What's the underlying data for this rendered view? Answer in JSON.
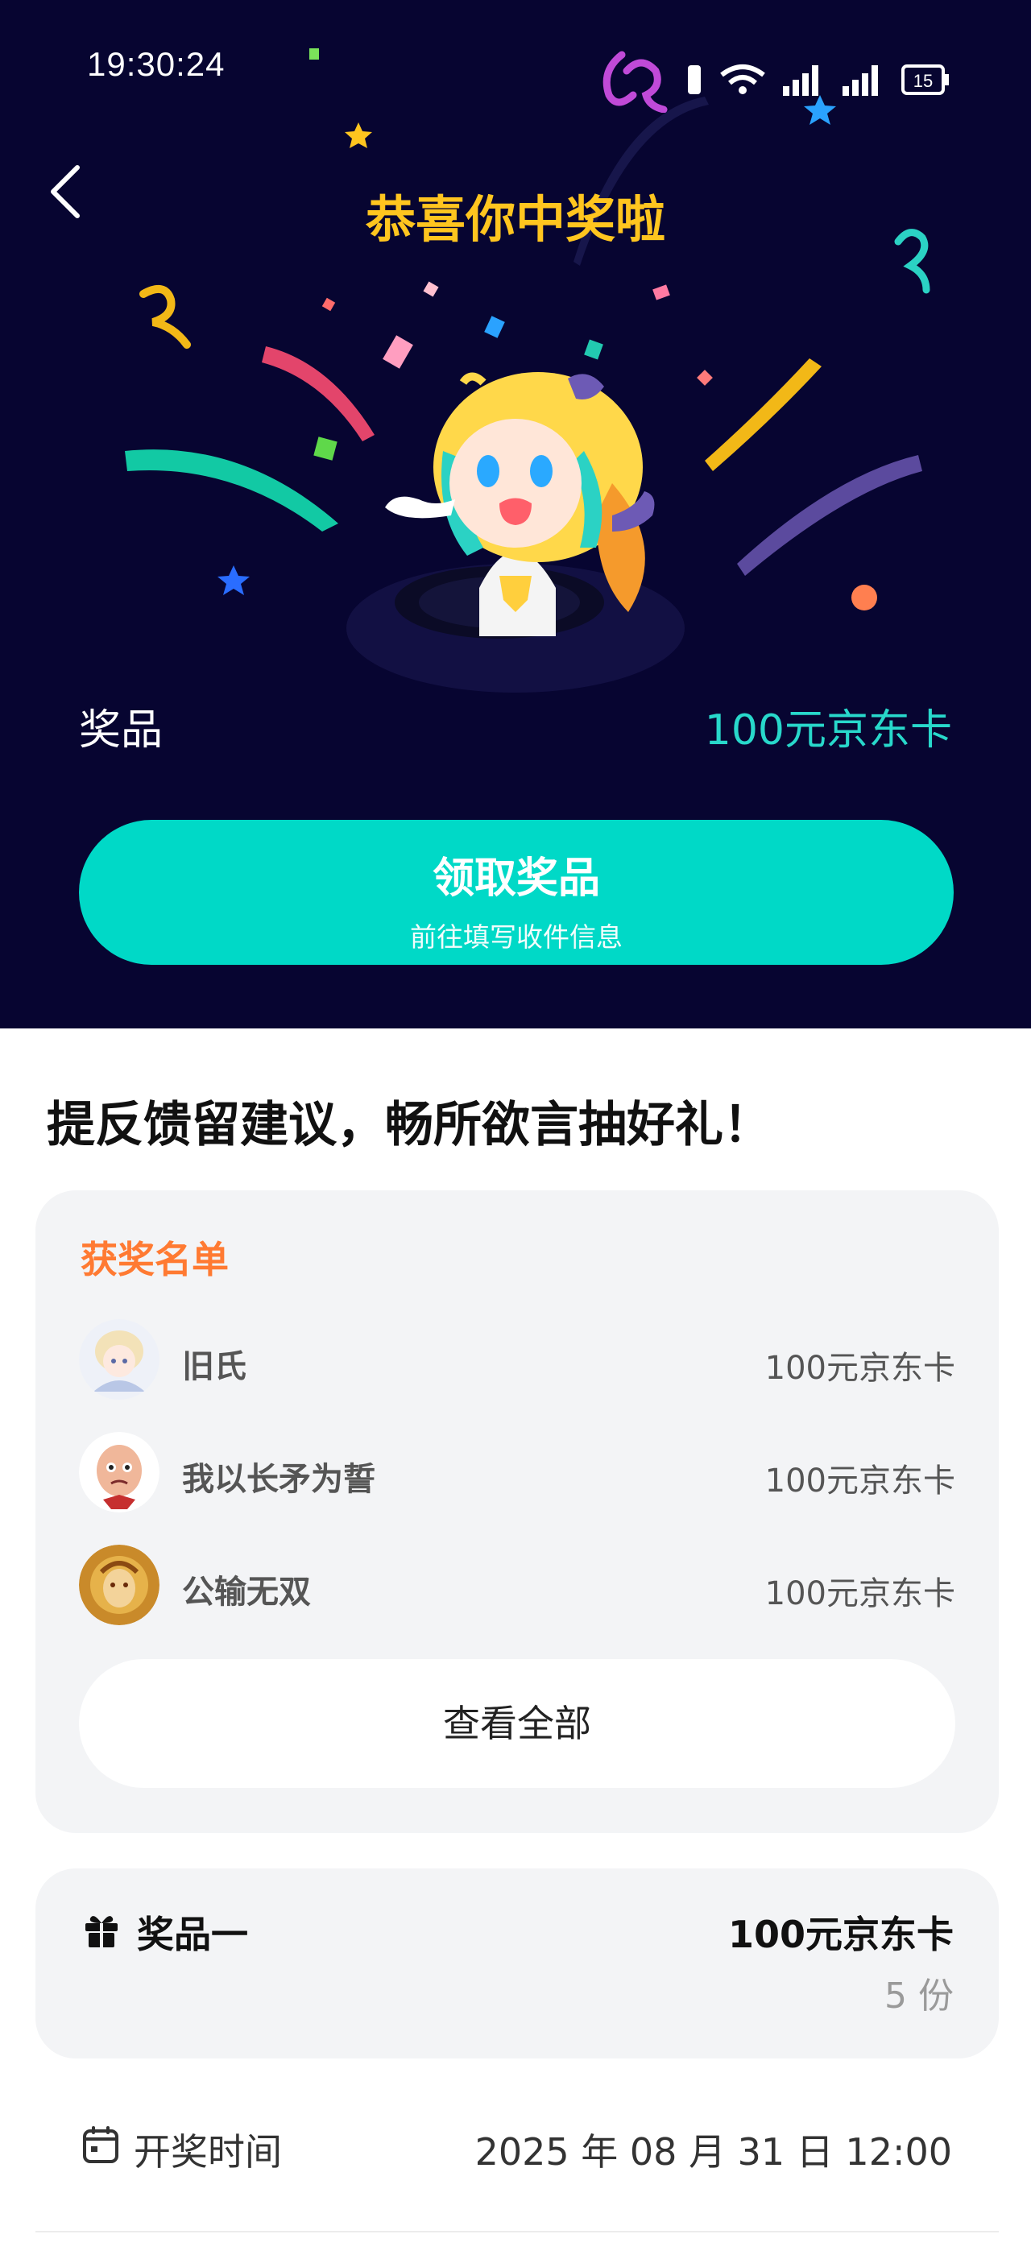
{
  "status_bar": {
    "time": "19:30:24",
    "icons": [
      "app-logo-icon",
      "vibrate-icon",
      "wifi-icon",
      "signal-icon",
      "signal-icon",
      "battery-icon"
    ],
    "battery_level": "15"
  },
  "hero": {
    "title": "恭喜你中奖啦",
    "prize_label": "奖品",
    "prize_value": "100元京东卡",
    "claim_button": {
      "label": "领取奖品",
      "sublabel": "前往填写收件信息"
    },
    "colors": {
      "background": "#070531",
      "title": "#ffc51f",
      "accent": "#00d9c7"
    }
  },
  "content": {
    "section_title": "提反馈留建议，畅所欲言抽好礼！",
    "winners": {
      "heading": "获奖名单",
      "items": [
        {
          "name": "旧氏",
          "prize": "100元京东卡"
        },
        {
          "name": "我以长矛为誓",
          "prize": "100元京东卡"
        },
        {
          "name": "公输无双",
          "prize": "100元京东卡"
        }
      ],
      "view_all": "查看全部"
    },
    "prize_card": {
      "label": "奖品一",
      "value": "100元京东卡",
      "quantity": "5 份"
    },
    "draw_time": {
      "label": "开奖时间",
      "value": "2025 年 08 月 31 日 12:00"
    }
  }
}
